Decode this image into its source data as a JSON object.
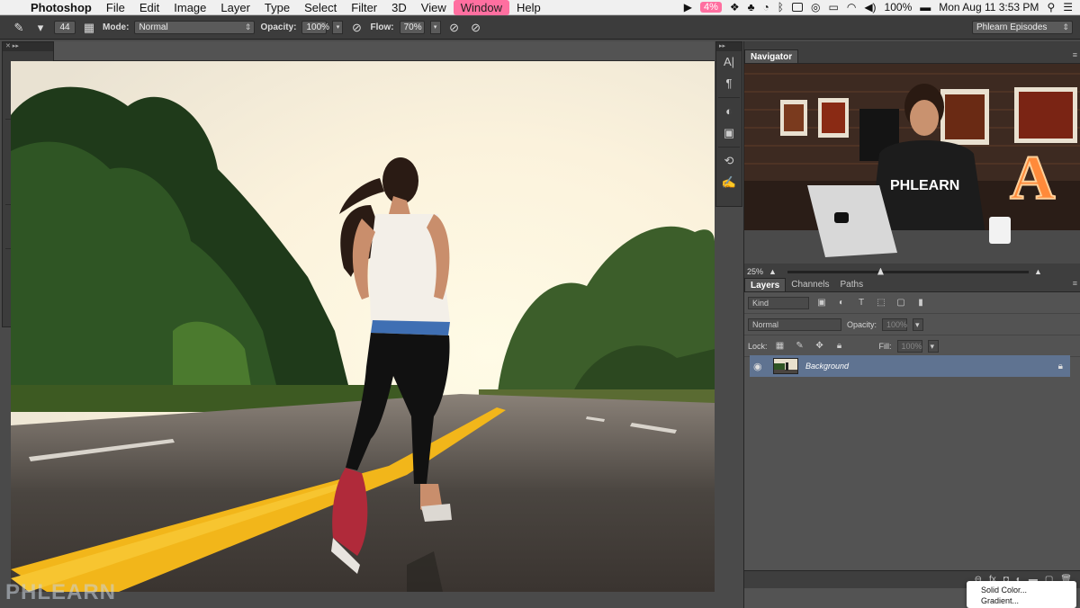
{
  "menubar": {
    "app": "Photoshop",
    "items": [
      "File",
      "Edit",
      "Image",
      "Layer",
      "Type",
      "Select",
      "Filter",
      "3D",
      "View",
      "Window",
      "Help"
    ],
    "highlighted": "Window",
    "cpu_badge": "4%",
    "battery": "100%",
    "datetime": "Mon Aug 11  3:53 PM"
  },
  "options": {
    "brush_size": "44",
    "mode_label": "Mode:",
    "mode_value": "Normal",
    "opacity_label": "Opacity:",
    "opacity_value": "100%",
    "flow_label": "Flow:",
    "flow_value": "70%",
    "workspace": "Phlearn Episodes"
  },
  "colors": {
    "foreground": "#e5179f",
    "background": "#f6d3dc",
    "accent": "#5f7391",
    "menu_highlight": "#ff6fa0"
  },
  "navigator": {
    "title": "Navigator",
    "zoom": "25%"
  },
  "layers": {
    "tabs": [
      "Layers",
      "Channels",
      "Paths"
    ],
    "filter_kind": "Kind",
    "blend_mode": "Normal",
    "opacity_label": "Opacity:",
    "opacity_value": "100%",
    "lock_label": "Lock:",
    "fill_label": "Fill:",
    "fill_value": "100%",
    "layer_name": "Background"
  },
  "popup_menu": {
    "items": [
      "Solid Color...",
      "Gradient..."
    ]
  },
  "watermark": "PHLEARN"
}
